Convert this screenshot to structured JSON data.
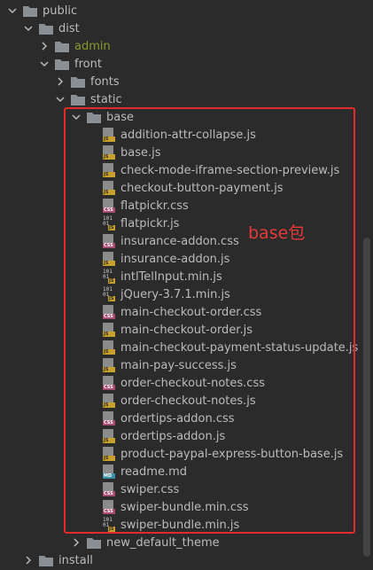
{
  "tree": {
    "public": "public",
    "dist": "dist",
    "admin": "admin",
    "front": "front",
    "fonts": "fonts",
    "static": "static",
    "base": "base",
    "files": [
      {
        "name": "addition-attr-collapse.js",
        "type": "js"
      },
      {
        "name": "base.js",
        "type": "js"
      },
      {
        "name": "check-mode-iframe-section-preview.js",
        "type": "js"
      },
      {
        "name": "checkout-button-payment.js",
        "type": "js"
      },
      {
        "name": "flatpickr.css",
        "type": "css"
      },
      {
        "name": "flatpickr.js",
        "type": "binjs"
      },
      {
        "name": "insurance-addon.css",
        "type": "css"
      },
      {
        "name": "insurance-addon.js",
        "type": "js"
      },
      {
        "name": "intlTelInput.min.js",
        "type": "binjs"
      },
      {
        "name": "jQuery-3.7.1.min.js",
        "type": "binjs"
      },
      {
        "name": "main-checkout-order.css",
        "type": "css"
      },
      {
        "name": "main-checkout-order.js",
        "type": "js"
      },
      {
        "name": "main-checkout-payment-status-update.js",
        "type": "js"
      },
      {
        "name": "main-pay-success.js",
        "type": "js"
      },
      {
        "name": "order-checkout-notes.css",
        "type": "css"
      },
      {
        "name": "order-checkout-notes.js",
        "type": "js"
      },
      {
        "name": "ordertips-addon.css",
        "type": "css"
      },
      {
        "name": "ordertips-addon.js",
        "type": "js"
      },
      {
        "name": "product-paypal-express-button-base.js",
        "type": "js"
      },
      {
        "name": "readme.md",
        "type": "md"
      },
      {
        "name": "swiper.css",
        "type": "css"
      },
      {
        "name": "swiper-bundle.min.css",
        "type": "css"
      },
      {
        "name": "swiper-bundle.min.js",
        "type": "binjs"
      }
    ],
    "new_default_theme": "new_default_theme",
    "install": "install"
  },
  "annotation": "base包",
  "colors": {
    "highlight_border": "#e22b2b",
    "annotation_text": "#e53a3a",
    "folder": "#8a8f94",
    "js_tag": "#c7a12e",
    "css_tag": "#a64c72",
    "md_tag": "#3d8fa6"
  }
}
